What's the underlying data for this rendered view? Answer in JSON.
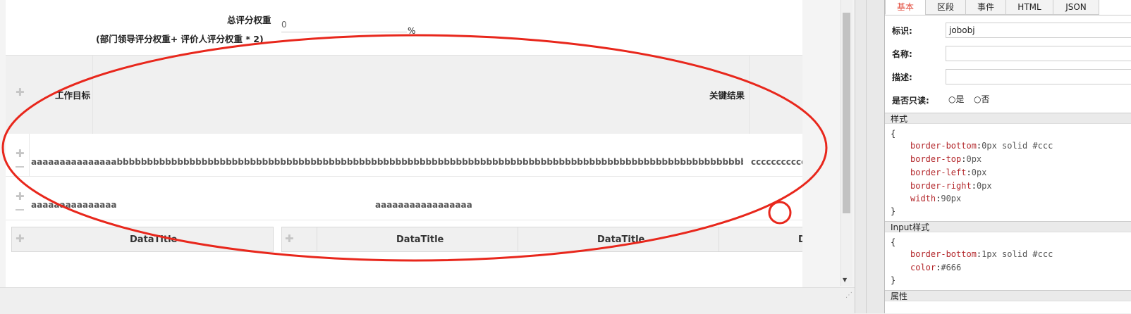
{
  "form": {
    "weight_label": "总评分权重",
    "weight_value": "0",
    "weight_formula": "(部门领导评分权重+ 评价人评分权重 * 2)",
    "percent_sign": "%"
  },
  "table": {
    "header_col1": "工作目标",
    "header_col2": "关键结果",
    "row1_col1": "aaaaaaaaaaaaaaabbbbbbbbbbbbbbbbbbbbbbbbbbbbbbbbbbbbbbbbbbbbbbbbbbbbbbbbbbbbbbbbbbbbbbbbbbbbbbbbbbbbbbbbbbbbbbbbbbbbbbbbbbbbbbbbbbbbbbbbbbb",
    "row1_col2": "ccccccccccc",
    "row2_col1": "aaaaaaaaaaaaaaa",
    "row2_col2": "aaaaaaaaaaaaaaaaa"
  },
  "data_titles": {
    "box1": "DataTitle",
    "box2_a": "DataTitle",
    "box2_b": "DataTitle",
    "box2_c": "D"
  },
  "panel": {
    "tabs": [
      "基本",
      "区段",
      "事件",
      "HTML",
      "JSON"
    ],
    "active_tab": "基本",
    "id_label": "标识:",
    "id_value": "jobobj",
    "name_label": "名称:",
    "desc_label": "描述:",
    "readonly_label": "是否只读:",
    "readonly_yes": "是",
    "readonly_no": "否",
    "style_section": "样式",
    "input_style_section": "Input样式",
    "attr_section": "属性",
    "open_brace": "{",
    "close_brace": "}",
    "style_rules": [
      {
        "prop": "border-bottom",
        "val": "0px solid #ccc"
      },
      {
        "prop": "border-top",
        "val": "0px"
      },
      {
        "prop": "border-left",
        "val": "0px"
      },
      {
        "prop": "border-right",
        "val": "0px"
      },
      {
        "prop": "width",
        "val": "90px"
      }
    ],
    "input_style_rules": [
      {
        "prop": "border-bottom",
        "val": "1px solid #ccc"
      },
      {
        "prop": "color",
        "val": "#666"
      }
    ]
  },
  "colors": {
    "annotation_red": "#e8271c",
    "tab_active_text": "#e24a3b",
    "css_property": "#b3272b"
  },
  "icons": [
    "plus-icon",
    "minus-icon",
    "scroll-down-arrow-icon",
    "resize-grip-icon",
    "radio-icon"
  ]
}
